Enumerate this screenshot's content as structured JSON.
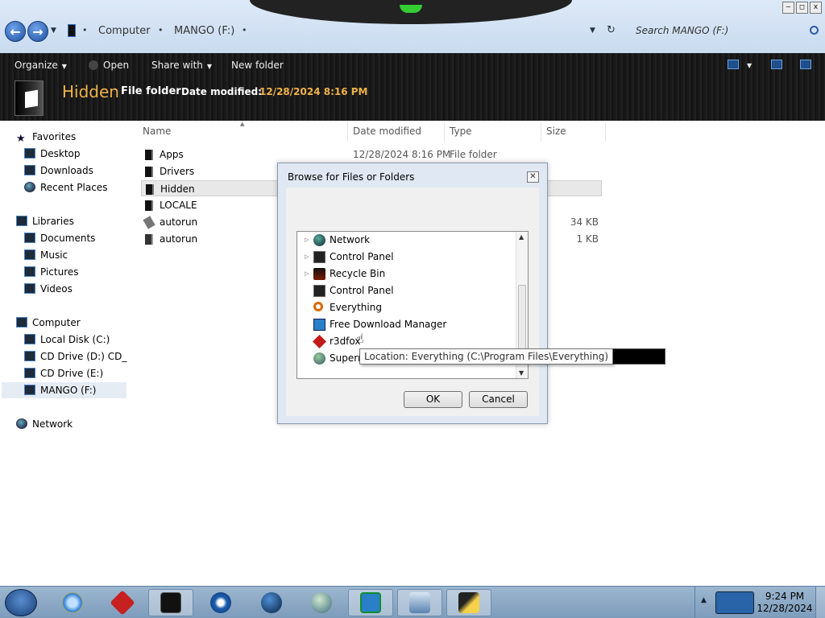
{
  "window": {
    "breadcrumb": [
      "Computer",
      "MANGO (F:)"
    ],
    "search_placeholder": "Search MANGO (F:)"
  },
  "toolbar": {
    "organize": "Organize",
    "open": "Open",
    "share_with": "Share with",
    "new_folder": "New folder"
  },
  "details": {
    "title": "Hidden",
    "kind": "File folder",
    "date_label": "Date modified:",
    "date_value": "12/28/2024 8:16 PM"
  },
  "nav": {
    "favorites": "Favorites",
    "desktop": "Desktop",
    "downloads": "Downloads",
    "recent_places": "Recent Places",
    "libraries": "Libraries",
    "documents": "Documents",
    "music": "Music",
    "pictures": "Pictures",
    "videos": "Videos",
    "computer": "Computer",
    "local_disk": "Local Disk (C:)",
    "cd_drive_d": "CD Drive (D:) CD_RC",
    "cd_drive_e": "CD Drive (E:)",
    "mango": "MANGO (F:)",
    "network": "Network"
  },
  "columns": {
    "name": "Name",
    "date_modified": "Date modified",
    "type": "Type",
    "size": "Size"
  },
  "files": [
    {
      "name": "Apps",
      "date": "12/28/2024 8:16 PM",
      "type": "File folder",
      "size": ""
    },
    {
      "name": "Drivers",
      "date": "",
      "type": "",
      "size": ""
    },
    {
      "name": "Hidden",
      "date": "",
      "type": "",
      "size": ""
    },
    {
      "name": "LOCALE",
      "date": "",
      "type": "",
      "size": ""
    },
    {
      "name": "autorun",
      "date": "",
      "type": "",
      "size": "34 KB"
    },
    {
      "name": "autorun",
      "date": "",
      "type": "",
      "size": "1 KB"
    }
  ],
  "dialog": {
    "title": "Browse for Files or Folders",
    "close": "✕",
    "items": [
      {
        "label": "Network",
        "expandable": true,
        "icon": "network-icon"
      },
      {
        "label": "Control Panel",
        "expandable": true,
        "icon": "control-panel-icon"
      },
      {
        "label": "Recycle Bin",
        "expandable": true,
        "icon": "recycle-bin-icon"
      },
      {
        "label": "Control Panel",
        "expandable": false,
        "icon": "control-panel-icon"
      },
      {
        "label": "Everything",
        "expandable": false,
        "icon": "everything-icon"
      },
      {
        "label": "Free Download Manager",
        "expandable": false,
        "icon": "fdm-icon"
      },
      {
        "label": "r3dfox",
        "expandable": false,
        "icon": "r3dfox-icon"
      },
      {
        "label": "Superm",
        "expandable": false,
        "icon": "supermium-icon"
      }
    ],
    "ok": "OK",
    "cancel": "Cancel"
  },
  "tooltip": "Location: Everything (C:\\Program Files\\Everything)",
  "clock": {
    "time": "9:24 PM",
    "date": "12/28/2024"
  },
  "colors": {
    "accent_orange": "#f0b24a",
    "toolbar_dark": "#1a1a1a",
    "taskbar": "#8ea9c6"
  }
}
